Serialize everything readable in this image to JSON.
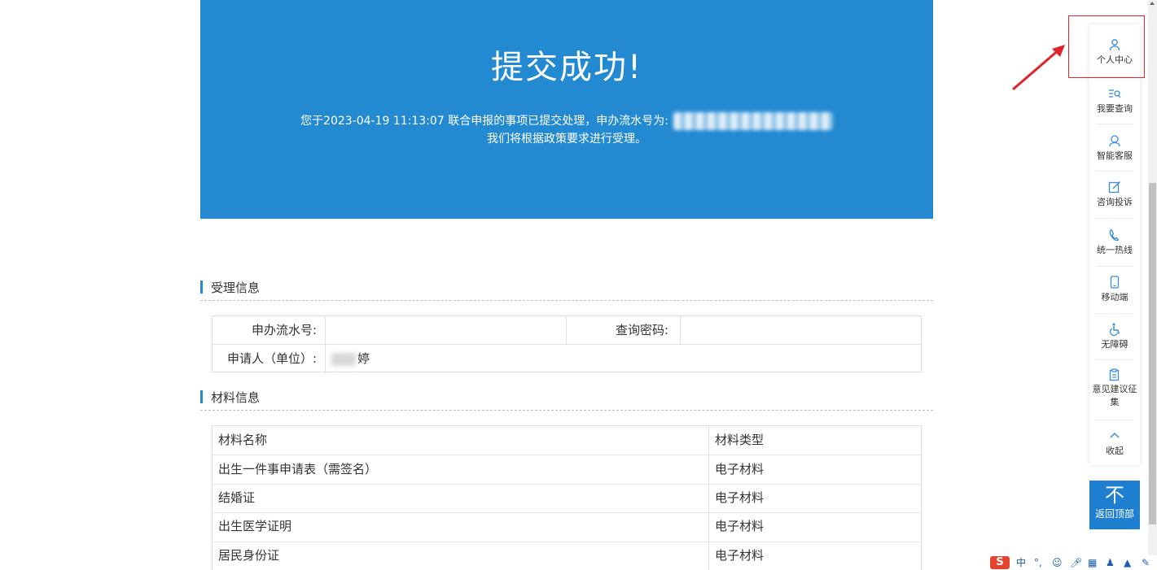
{
  "banner": {
    "title": "提交成功!",
    "line1_text": "您于2023-04-19 11:13:07 联合申报的事项已提交处理，申办流水号为:",
    "line2_text": "我们将根据政策要求进行受理。"
  },
  "accept_section": {
    "title": "受理信息",
    "serial_label": "申办流水号:",
    "serial_value": "",
    "password_label": "查询密码:",
    "password_value": "",
    "applicant_label": "申请人（单位）:",
    "applicant_value": "婷"
  },
  "material_section": {
    "title": "材料信息",
    "headers": {
      "name": "材料名称",
      "type": "材料类型"
    },
    "rows": [
      {
        "name": "出生一件事申请表（需签名）",
        "type": "电子材料"
      },
      {
        "name": "结婚证",
        "type": "电子材料"
      },
      {
        "name": "出生医学证明",
        "type": "电子材料"
      },
      {
        "name": "居民身份证",
        "type": "电子材料"
      }
    ]
  },
  "float_bar": {
    "items": [
      {
        "label": "个人中心",
        "icon": "user-icon"
      },
      {
        "label": "我要查询",
        "icon": "search-list-icon"
      },
      {
        "label": "智能客服",
        "icon": "service-icon"
      },
      {
        "label": "咨询投诉",
        "icon": "edit-icon"
      },
      {
        "label": "统一热线",
        "icon": "phone-icon"
      },
      {
        "label": "移动端",
        "icon": "mobile-icon"
      },
      {
        "label": "无障碍",
        "icon": "accessibility-icon"
      },
      {
        "label": "意见建议征集",
        "icon": "clipboard-icon"
      },
      {
        "label": "收起",
        "icon": "chevron-up-icon"
      }
    ],
    "back_top_label": "返回顶部",
    "back_top_icon": "arrow-top-icon"
  },
  "ime": {
    "logo": "S",
    "mode": "中"
  },
  "colors": {
    "banner": "#238ad1",
    "accent": "#238ad1",
    "annotation_red": "#e0242c",
    "back_top": "#1e7fd0"
  }
}
